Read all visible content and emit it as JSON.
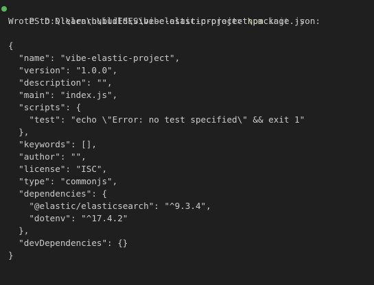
{
  "terminal": {
    "prompt": "PS D:\\learn\\buildES\\vibe-elastic-project> ",
    "command": "npm",
    "command_args": " init -y",
    "status_color": "#57b85a",
    "output_lines": [
      "Wrote to D:\\learn\\buildES\\vibe-elastic-project\\package.json:",
      "",
      "{",
      "  \"name\": \"vibe-elastic-project\",",
      "  \"version\": \"1.0.0\",",
      "  \"description\": \"\",",
      "  \"main\": \"index.js\",",
      "  \"scripts\": {",
      "    \"test\": \"echo \\\"Error: no test specified\\\" && exit 1\"",
      "  },",
      "  \"keywords\": [],",
      "  \"author\": \"\",",
      "  \"license\": \"ISC\",",
      "  \"type\": \"commonjs\",",
      "  \"dependencies\": {",
      "    \"@elastic/elasticsearch\": \"^9.3.4\",",
      "    \"dotenv\": \"^17.4.2\"",
      "  },",
      "  \"devDependencies\": {}",
      "}"
    ]
  }
}
